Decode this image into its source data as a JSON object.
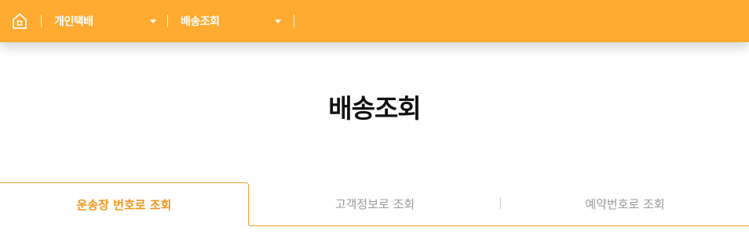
{
  "header": {
    "background": "#ffab32",
    "home_icon": "home-icon",
    "category_dropdown": {
      "selected": "개인택배"
    },
    "menu_dropdown": {
      "selected": "배송조회"
    },
    "caret_icon": "caret-down-icon"
  },
  "main": {
    "title": "배송조회",
    "tabs": [
      {
        "label": "운송장 번호로 조회",
        "active": true
      },
      {
        "label": "고객정보로 조회",
        "active": false
      },
      {
        "label": "예약번호로 조회",
        "active": false
      }
    ],
    "accent_color": "#f2961e"
  }
}
